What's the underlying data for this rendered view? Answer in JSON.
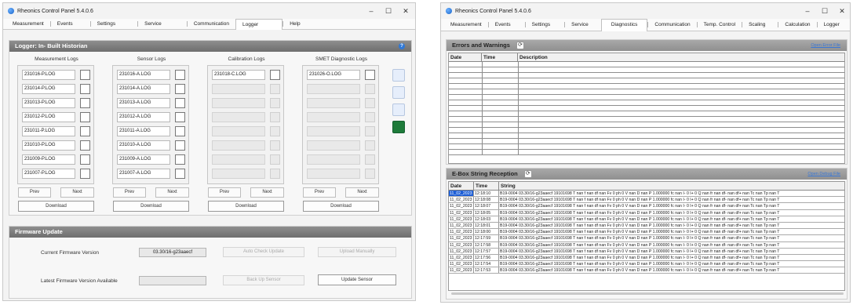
{
  "left": {
    "title": "Rheonics Control Panel 5.4.0.6",
    "tabs": [
      "Measurement",
      "Events",
      "Settings",
      "Service",
      "Communication",
      "Logger",
      "Help"
    ],
    "active_tab": "Logger",
    "logger_title": "Logger: In- Built Historian",
    "groups": [
      {
        "label": "Measurement Logs",
        "files": [
          "231016-P.LOG",
          "231014-P.LOG",
          "231013-P.LOG",
          "231012-P.LOG",
          "231011-P.LOG",
          "231010-P.LOG",
          "231009-P.LOG",
          "231007-P.LOG"
        ]
      },
      {
        "label": "Sensor Logs",
        "files": [
          "231016-A.LOG",
          "231014-A.LOG",
          "231013-A.LOG",
          "231012-A.LOG",
          "231011-A.LOG",
          "231010-A.LOG",
          "231009-A.LOG",
          "231007-A.LOG"
        ]
      },
      {
        "label": "Calibration Logs",
        "files": [
          "231018-C.LOG",
          "",
          "",
          "",
          "",
          "",
          "",
          ""
        ]
      },
      {
        "label": "SMET Diagnostic Logs",
        "files": [
          "231026-O.LOG",
          "",
          "",
          "",
          "",
          "",
          "",
          ""
        ]
      }
    ],
    "prev_label": "Prev",
    "next_label": "Next",
    "download_label": "Download",
    "firmware": {
      "title": "Firmware Update",
      "current_label": "Current Firmware Version",
      "current_value": "03.30/16-g23aaecf",
      "latest_label": "Latest Firmware Version Available",
      "latest_value": "",
      "auto_check": "Auto Check Update",
      "upload_manually": "Upload Manually",
      "back_up_sensor": "Back Up Sensor",
      "update_sensor": "Update Sensor"
    }
  },
  "right": {
    "title": "Rheonics Control Panel 5.4.0.6",
    "tabs": [
      "Measurement",
      "Events",
      "Settings",
      "Service",
      "Diagnostics",
      "Communication",
      "Temp. Control",
      "Scaling",
      "Calculation",
      "Logger"
    ],
    "active_tab": "Diagnostics",
    "errors": {
      "title": "Errors and Warnings",
      "link": "Open Error File",
      "headers": [
        "Date",
        "Time",
        "Description"
      ]
    },
    "ebox": {
      "title": "E-Box String Reception",
      "link": "Open Debug File",
      "headers": [
        "Date",
        "Time",
        "String"
      ],
      "rows": [
        {
          "date": "11_02_2023",
          "time": "12:18:10",
          "string": "B19-0004 03.30/16-g23aaecf 19101698 T nan f nan df nan Fv 0 ph 0 V nan D nan P 1.000000 fc nan I- 0 I+ 0 Q nan fr nan df- nan df+ nan Tc nan Tp nan T"
        },
        {
          "date": "11_02_2023",
          "time": "12:18:08",
          "string": "B19-0004 03.30/16-g23aaecf 19101698 T nan f nan df nan Fv 0 ph 0 V nan D nan P 1.000000 fc nan I- 0 I+ 0 Q nan fr nan df- nan df+ nan Tc nan Tp nan T"
        },
        {
          "date": "11_02_2023",
          "time": "12:18:07",
          "string": "B19-0004 03.30/16-g23aaecf 19101698 T nan f nan df nan Fv 0 ph 0 V nan D nan P 1.000000 fc nan I- 0 I+ 0 Q nan fr nan df- nan df+ nan Tc nan Tp nan T"
        },
        {
          "date": "11_02_2023",
          "time": "12:18:05",
          "string": "B19-0004 03.30/16-g23aaecf 19101698 T nan f nan df nan Fv 0 ph 0 V nan D nan P 1.000000 fc nan I- 0 I+ 0 Q nan fr nan df- nan df+ nan Tc nan Tp nan T"
        },
        {
          "date": "11_02_2023",
          "time": "12:18:03",
          "string": "B19-0004 03.30/16-g23aaecf 19101698 T nan f nan df nan Fv 0 ph 0 V nan D nan P 1.000000 fc nan I- 0 I+ 0 Q nan fr nan df- nan df+ nan Tc nan Tp nan T"
        },
        {
          "date": "11_02_2023",
          "time": "12:18:01",
          "string": "B19-0004 03.30/16-g23aaecf 19101698 T nan f nan df nan Fv 0 ph 0 V nan D nan P 1.000000 fc nan I- 0 I+ 0 Q nan fr nan df- nan df+ nan Tc nan Tp nan T"
        },
        {
          "date": "11_02_2023",
          "time": "12:18:00",
          "string": "B19-0004 03.30/16-g23aaecf 19101698 T nan f nan df nan Fv 0 ph 0 V nan D nan P 1.000000 fc nan I- 0 I+ 0 Q nan fr nan df- nan df+ nan Tc nan Tp nan T"
        },
        {
          "date": "11_02_2023",
          "time": "12:17:59",
          "string": "B19-0004 03.30/16-g23aaecf 19101698 T nan f nan df nan Fv 0 ph 0 V nan D nan P 1.000000 fc nan I- 0 I+ 0 Q nan fr nan df- nan df+ nan Tc nan Tp nan T"
        },
        {
          "date": "11_02_2023",
          "time": "12:17:58",
          "string": "B19-0004 03.30/16-g23aaecf 19101698 T nan f nan df nan Fv 0 ph 0 V nan D nan P 1.000000 fc nan I- 0 I+ 0 Q nan fr nan df- nan df+ nan Tc nan Tp nan T"
        },
        {
          "date": "11_02_2023",
          "time": "12:17:57",
          "string": "B19-0004 03.30/16-g23aaecf 19101698 T nan f nan df nan Fv 0 ph 0 V nan D nan P 1.000000 fc nan I- 0 I+ 0 Q nan fr nan df- nan df+ nan Tc nan Tp nan T"
        },
        {
          "date": "11_02_2023",
          "time": "12:17:56",
          "string": "B19-0004 03.30/16-g23aaecf 19101698 T nan f nan df nan Fv 0 ph 0 V nan D nan P 1.000000 fc nan I- 0 I+ 0 Q nan fr nan df- nan df+ nan Tc nan Tp nan T"
        },
        {
          "date": "11_02_2023",
          "time": "12:17:54",
          "string": "B19-0004 03.30/16-g23aaecf 19101698 T nan f nan df nan Fv 0 ph 0 V nan D nan P 1.000000 fc nan I- 0 I+ 0 Q nan fr nan df- nan df+ nan Tc nan Tp nan T"
        },
        {
          "date": "11_02_2023",
          "time": "12:17:53",
          "string": "B19-0004 03.30/16-g23aaecf 19101698 T nan f nan df nan Fv 0 ph 0 V nan D nan P 1.000000 fc nan I- 0 I+ 0 Q nan fr nan df- nan df+ nan Tc nan Tp nan T"
        }
      ]
    }
  },
  "icons": [
    "app-icon",
    "minimize-icon",
    "maximize-icon",
    "close-icon",
    "help-icon",
    "refresh-icon",
    "export-icon",
    "excel-icon"
  ],
  "colors": {
    "header_bar": "#7a7a7a",
    "selection": "#1e5fd6",
    "link": "#3a78d6",
    "help": "#2f78d6"
  }
}
